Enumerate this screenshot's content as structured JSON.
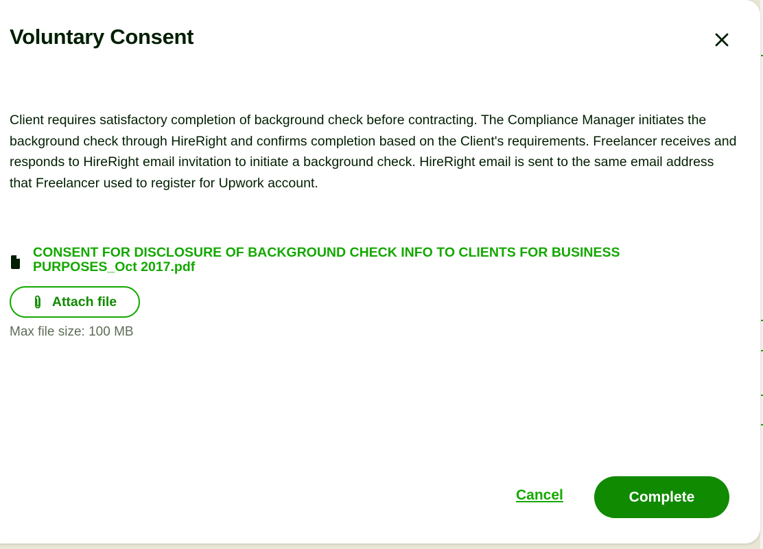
{
  "dialog": {
    "title": "Voluntary Consent",
    "description": "Client requires satisfactory completion of background check before contracting. The Compliance Manager initiates the background check through HireRight and confirms completion based on the Client's requirements. Freelancer receives and responds to HireRight email invitation to initiate a background check. HireRight email is sent to the same email address that Freelancer used to register for Upwork account.",
    "attachment": {
      "filename": "CONSENT FOR DISCLOSURE OF BACKGROUND CHECK INFO TO CLIENTS FOR BUSINESS PURPOSES_Oct 2017.pdf",
      "icon": "document-icon"
    },
    "attach_button": {
      "label": "Attach file",
      "icon": "paperclip-icon"
    },
    "max_file_size": "Max file size: 100 MB",
    "close_icon": "close-icon",
    "footer": {
      "cancel_label": "Cancel",
      "complete_label": "Complete"
    }
  },
  "colors": {
    "brand_green": "#14a800",
    "button_green": "#108a00",
    "text_dark": "#001e00",
    "text_muted": "#5e6d55",
    "backdrop": "#e9e6d6"
  }
}
